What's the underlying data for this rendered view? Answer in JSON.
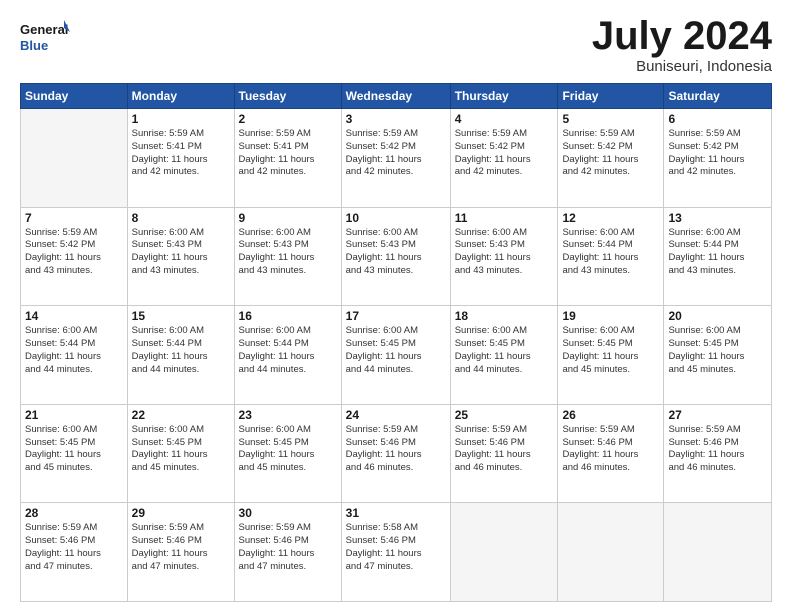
{
  "logo": {
    "text_general": "General",
    "text_blue": "Blue"
  },
  "header": {
    "title": "July 2024",
    "subtitle": "Buniseuri, Indonesia"
  },
  "days_of_week": [
    "Sunday",
    "Monday",
    "Tuesday",
    "Wednesday",
    "Thursday",
    "Friday",
    "Saturday"
  ],
  "weeks": [
    [
      {
        "day": "",
        "empty": true
      },
      {
        "day": "1",
        "sunrise": "5:59 AM",
        "sunset": "5:41 PM",
        "daylight": "11 hours and 42 minutes."
      },
      {
        "day": "2",
        "sunrise": "5:59 AM",
        "sunset": "5:41 PM",
        "daylight": "11 hours and 42 minutes."
      },
      {
        "day": "3",
        "sunrise": "5:59 AM",
        "sunset": "5:42 PM",
        "daylight": "11 hours and 42 minutes."
      },
      {
        "day": "4",
        "sunrise": "5:59 AM",
        "sunset": "5:42 PM",
        "daylight": "11 hours and 42 minutes."
      },
      {
        "day": "5",
        "sunrise": "5:59 AM",
        "sunset": "5:42 PM",
        "daylight": "11 hours and 42 minutes."
      },
      {
        "day": "6",
        "sunrise": "5:59 AM",
        "sunset": "5:42 PM",
        "daylight": "11 hours and 42 minutes."
      }
    ],
    [
      {
        "day": "7",
        "sunrise": "5:59 AM",
        "sunset": "5:42 PM",
        "daylight": "11 hours and 43 minutes."
      },
      {
        "day": "8",
        "sunrise": "6:00 AM",
        "sunset": "5:43 PM",
        "daylight": "11 hours and 43 minutes."
      },
      {
        "day": "9",
        "sunrise": "6:00 AM",
        "sunset": "5:43 PM",
        "daylight": "11 hours and 43 minutes."
      },
      {
        "day": "10",
        "sunrise": "6:00 AM",
        "sunset": "5:43 PM",
        "daylight": "11 hours and 43 minutes."
      },
      {
        "day": "11",
        "sunrise": "6:00 AM",
        "sunset": "5:43 PM",
        "daylight": "11 hours and 43 minutes."
      },
      {
        "day": "12",
        "sunrise": "6:00 AM",
        "sunset": "5:44 PM",
        "daylight": "11 hours and 43 minutes."
      },
      {
        "day": "13",
        "sunrise": "6:00 AM",
        "sunset": "5:44 PM",
        "daylight": "11 hours and 43 minutes."
      }
    ],
    [
      {
        "day": "14",
        "sunrise": "6:00 AM",
        "sunset": "5:44 PM",
        "daylight": "11 hours and 44 minutes."
      },
      {
        "day": "15",
        "sunrise": "6:00 AM",
        "sunset": "5:44 PM",
        "daylight": "11 hours and 44 minutes."
      },
      {
        "day": "16",
        "sunrise": "6:00 AM",
        "sunset": "5:44 PM",
        "daylight": "11 hours and 44 minutes."
      },
      {
        "day": "17",
        "sunrise": "6:00 AM",
        "sunset": "5:45 PM",
        "daylight": "11 hours and 44 minutes."
      },
      {
        "day": "18",
        "sunrise": "6:00 AM",
        "sunset": "5:45 PM",
        "daylight": "11 hours and 44 minutes."
      },
      {
        "day": "19",
        "sunrise": "6:00 AM",
        "sunset": "5:45 PM",
        "daylight": "11 hours and 45 minutes."
      },
      {
        "day": "20",
        "sunrise": "6:00 AM",
        "sunset": "5:45 PM",
        "daylight": "11 hours and 45 minutes."
      }
    ],
    [
      {
        "day": "21",
        "sunrise": "6:00 AM",
        "sunset": "5:45 PM",
        "daylight": "11 hours and 45 minutes."
      },
      {
        "day": "22",
        "sunrise": "6:00 AM",
        "sunset": "5:45 PM",
        "daylight": "11 hours and 45 minutes."
      },
      {
        "day": "23",
        "sunrise": "6:00 AM",
        "sunset": "5:45 PM",
        "daylight": "11 hours and 45 minutes."
      },
      {
        "day": "24",
        "sunrise": "5:59 AM",
        "sunset": "5:46 PM",
        "daylight": "11 hours and 46 minutes."
      },
      {
        "day": "25",
        "sunrise": "5:59 AM",
        "sunset": "5:46 PM",
        "daylight": "11 hours and 46 minutes."
      },
      {
        "day": "26",
        "sunrise": "5:59 AM",
        "sunset": "5:46 PM",
        "daylight": "11 hours and 46 minutes."
      },
      {
        "day": "27",
        "sunrise": "5:59 AM",
        "sunset": "5:46 PM",
        "daylight": "11 hours and 46 minutes."
      }
    ],
    [
      {
        "day": "28",
        "sunrise": "5:59 AM",
        "sunset": "5:46 PM",
        "daylight": "11 hours and 47 minutes."
      },
      {
        "day": "29",
        "sunrise": "5:59 AM",
        "sunset": "5:46 PM",
        "daylight": "11 hours and 47 minutes."
      },
      {
        "day": "30",
        "sunrise": "5:59 AM",
        "sunset": "5:46 PM",
        "daylight": "11 hours and 47 minutes."
      },
      {
        "day": "31",
        "sunrise": "5:58 AM",
        "sunset": "5:46 PM",
        "daylight": "11 hours and 47 minutes."
      },
      {
        "day": "",
        "empty": true
      },
      {
        "day": "",
        "empty": true
      },
      {
        "day": "",
        "empty": true
      }
    ]
  ],
  "labels": {
    "sunrise": "Sunrise:",
    "sunset": "Sunset:",
    "daylight": "Daylight:"
  }
}
